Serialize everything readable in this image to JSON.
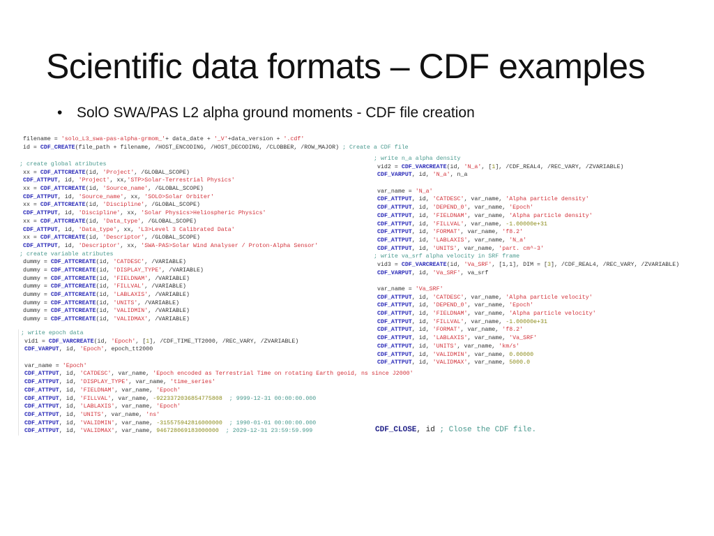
{
  "slide": {
    "title": "Scientific data formats – CDF examples",
    "bullet_icon": "•",
    "bullet": "SolO SWA/PAS L2 alpha ground moments  - CDF file creation"
  },
  "code_top": [
    [
      [
        "",
        " filename = "
      ],
      [
        "str",
        "'solo_L3_swa-pas-alpha-grmom_'"
      ],
      [
        "",
        "+ data_date + "
      ],
      [
        "str",
        "'_V'"
      ],
      [
        "",
        "+data_version + "
      ],
      [
        "str",
        "'.cdf'"
      ]
    ],
    [
      [
        "",
        " id = "
      ],
      [
        "kw",
        "CDF_CREATE"
      ],
      [
        "",
        "(file_path + filename, /HOST_ENCODING, /HOST_DECODING, /CLOBBER, /ROW_MAJOR) "
      ],
      [
        "cm",
        "; Create a CDF file"
      ]
    ]
  ],
  "code_global": [
    [
      [
        "cm",
        "; create global atributes"
      ]
    ],
    [
      [
        "",
        " xx = "
      ],
      [
        "kw",
        "CDF_ATTCREATE"
      ],
      [
        "",
        "(id, "
      ],
      [
        "str",
        "'Project'"
      ],
      [
        "",
        ", /GLOBAL_SCOPE)"
      ]
    ],
    [
      [
        "",
        " "
      ],
      [
        "kw",
        "CDF_ATTPUT"
      ],
      [
        "",
        ", id, "
      ],
      [
        "str",
        "'Project'"
      ],
      [
        "",
        ", xx,"
      ],
      [
        "str",
        "'STP>Solar-Terrestrial Physics'"
      ]
    ],
    [
      [
        "",
        " xx = "
      ],
      [
        "kw",
        "CDF_ATTCREATE"
      ],
      [
        "",
        "(id, "
      ],
      [
        "str",
        "'Source_name'"
      ],
      [
        "",
        ", /GLOBAL_SCOPE)"
      ]
    ],
    [
      [
        "",
        " "
      ],
      [
        "kw",
        "CDF_ATTPUT"
      ],
      [
        "",
        ", id, "
      ],
      [
        "str",
        "'Source_name'"
      ],
      [
        "",
        ", xx, "
      ],
      [
        "str",
        "'SOLO>Solar Orbiter'"
      ]
    ],
    [
      [
        "",
        " xx = "
      ],
      [
        "kw",
        "CDF_ATTCREATE"
      ],
      [
        "",
        "(id, "
      ],
      [
        "str",
        "'Discipline'"
      ],
      [
        "",
        ", /GLOBAL_SCOPE)"
      ]
    ],
    [
      [
        "",
        " "
      ],
      [
        "kw",
        "CDF_ATTPUT"
      ],
      [
        "",
        ", id, "
      ],
      [
        "str",
        "'Discipline'"
      ],
      [
        "",
        ", xx, "
      ],
      [
        "str",
        "'Solar Physics>Heliospheric Physics'"
      ]
    ],
    [
      [
        "",
        " xx = "
      ],
      [
        "kw",
        "CDF_ATTCREATE"
      ],
      [
        "",
        "(id, "
      ],
      [
        "str",
        "'Data_type'"
      ],
      [
        "",
        ", /GLOBAL_SCOPE)"
      ]
    ],
    [
      [
        "",
        " "
      ],
      [
        "kw",
        "CDF_ATTPUT"
      ],
      [
        "",
        ", id, "
      ],
      [
        "str",
        "'Data_type'"
      ],
      [
        "",
        ", xx, "
      ],
      [
        "str",
        "'L3>Level 3 Calibrated Data'"
      ]
    ],
    [
      [
        "",
        " xx = "
      ],
      [
        "kw",
        "CDF_ATTCREATE"
      ],
      [
        "",
        "(id, "
      ],
      [
        "str",
        "'Descriptor'"
      ],
      [
        "",
        ", /GLOBAL_SCOPE)"
      ]
    ],
    [
      [
        "",
        " "
      ],
      [
        "kw",
        "CDF_ATTPUT"
      ],
      [
        "",
        ", id, "
      ],
      [
        "str",
        "'Descriptor'"
      ],
      [
        "",
        ", xx, "
      ],
      [
        "str",
        "'SWA-PAS>Solar Wind Analyser / Proton-Alpha Sensor'"
      ]
    ],
    [
      [
        "cm",
        "; create variable atributes"
      ]
    ],
    [
      [
        "",
        " dummy = "
      ],
      [
        "kw",
        "CDF_ATTCREATE"
      ],
      [
        "",
        "(id, "
      ],
      [
        "str",
        "'CATDESC'"
      ],
      [
        "",
        ", /VARIABLE)"
      ]
    ],
    [
      [
        "",
        " dummy = "
      ],
      [
        "kw",
        "CDF_ATTCREATE"
      ],
      [
        "",
        "(id, "
      ],
      [
        "str",
        "'DISPLAY_TYPE'"
      ],
      [
        "",
        ", /VARIABLE)"
      ]
    ],
    [
      [
        "",
        " dummy = "
      ],
      [
        "kw",
        "CDF_ATTCREATE"
      ],
      [
        "",
        "(id, "
      ],
      [
        "str",
        "'FIELDNAM'"
      ],
      [
        "",
        ", /VARIABLE)"
      ]
    ],
    [
      [
        "",
        " dummy = "
      ],
      [
        "kw",
        "CDF_ATTCREATE"
      ],
      [
        "",
        "(id, "
      ],
      [
        "str",
        "'FILLVAL'"
      ],
      [
        "",
        ", /VARIABLE)"
      ]
    ],
    [
      [
        "",
        " dummy = "
      ],
      [
        "kw",
        "CDF_ATTCREATE"
      ],
      [
        "",
        "(id, "
      ],
      [
        "str",
        "'LABLAXIS'"
      ],
      [
        "",
        ", /VARIABLE)"
      ]
    ],
    [
      [
        "",
        " dummy = "
      ],
      [
        "kw",
        "CDF_ATTCREATE"
      ],
      [
        "",
        "(id, "
      ],
      [
        "str",
        "'UNITS'"
      ],
      [
        "",
        ", /VARIABLE)"
      ]
    ],
    [
      [
        "",
        " dummy = "
      ],
      [
        "kw",
        "CDF_ATTCREATE"
      ],
      [
        "",
        "(id, "
      ],
      [
        "str",
        "'VALIDMIN'"
      ],
      [
        "",
        ", /VARIABLE)"
      ]
    ],
    [
      [
        "",
        " dummy = "
      ],
      [
        "kw",
        "CDF_ATTCREATE"
      ],
      [
        "",
        "(id, "
      ],
      [
        "str",
        "'VALIDMAX'"
      ],
      [
        "",
        ", /VARIABLE)"
      ]
    ]
  ],
  "code_epoch": [
    [
      [
        "cm",
        "; write epoch data"
      ]
    ],
    [
      [
        "",
        " vid1 = "
      ],
      [
        "kw",
        "CDF_VARCREATE"
      ],
      [
        "",
        "(id, "
      ],
      [
        "str",
        "'Epoch'"
      ],
      [
        "",
        ", ["
      ],
      [
        "num",
        "1"
      ],
      [
        "",
        "], /CDF_TIME_TT2000, /REC_VARY, /ZVARIABLE)"
      ]
    ],
    [
      [
        "",
        " "
      ],
      [
        "kw",
        "CDF_VARPUT"
      ],
      [
        "",
        ", id, "
      ],
      [
        "str",
        "'Epoch'"
      ],
      [
        "",
        ", epoch_tt2000"
      ]
    ],
    [
      [
        "",
        ""
      ]
    ],
    [
      [
        "",
        " var_name = "
      ],
      [
        "str",
        "'Epoch'"
      ]
    ],
    [
      [
        "",
        " "
      ],
      [
        "kw",
        "CDF_ATTPUT"
      ],
      [
        "",
        ", id, "
      ],
      [
        "str",
        "'CATDESC'"
      ],
      [
        "",
        ", var_name, "
      ],
      [
        "str",
        "'Epoch encoded as Terrestrial Time on rotating Earth geoid, ns since J2000'"
      ]
    ],
    [
      [
        "",
        " "
      ],
      [
        "kw",
        "CDF_ATTPUT"
      ],
      [
        "",
        ", id, "
      ],
      [
        "str",
        "'DISPLAY_TYPE'"
      ],
      [
        "",
        ", var_name, "
      ],
      [
        "str",
        "'time_series'"
      ]
    ],
    [
      [
        "",
        " "
      ],
      [
        "kw",
        "CDF_ATTPUT"
      ],
      [
        "",
        ", id, "
      ],
      [
        "str",
        "'FIELDNAM'"
      ],
      [
        "",
        ", var_name, "
      ],
      [
        "str",
        "'Epoch'"
      ]
    ],
    [
      [
        "",
        " "
      ],
      [
        "kw",
        "CDF_ATTPUT"
      ],
      [
        "",
        ", id, "
      ],
      [
        "str",
        "'FILLVAL'"
      ],
      [
        "",
        ", var_name, "
      ],
      [
        "num",
        "-9223372036854775808"
      ],
      [
        "",
        "  "
      ],
      [
        "cm",
        "; 9999-12-31 00:00:00.000"
      ]
    ],
    [
      [
        "",
        " "
      ],
      [
        "kw",
        "CDF_ATTPUT"
      ],
      [
        "",
        ", id, "
      ],
      [
        "str",
        "'LABLAXIS'"
      ],
      [
        "",
        ", var_name, "
      ],
      [
        "str",
        "'Epoch'"
      ]
    ],
    [
      [
        "",
        " "
      ],
      [
        "kw",
        "CDF_ATTPUT"
      ],
      [
        "",
        ", id, "
      ],
      [
        "str",
        "'UNITS'"
      ],
      [
        "",
        ", var_name, "
      ],
      [
        "str",
        "'ns'"
      ]
    ],
    [
      [
        "",
        " "
      ],
      [
        "kw",
        "CDF_ATTPUT"
      ],
      [
        "",
        ", id, "
      ],
      [
        "str",
        "'VALIDMIN'"
      ],
      [
        "",
        ", var_name, "
      ],
      [
        "num",
        "-315575942816000000"
      ],
      [
        "",
        "  "
      ],
      [
        "cm",
        "; 1990-01-01 00:00:00.000"
      ]
    ],
    [
      [
        "",
        " "
      ],
      [
        "kw",
        "CDF_ATTPUT"
      ],
      [
        "",
        ", id, "
      ],
      [
        "str",
        "'VALIDMAX'"
      ],
      [
        "",
        ", var_name, "
      ],
      [
        "num",
        "946728069183000000"
      ],
      [
        "",
        "  "
      ],
      [
        "cm",
        "; 2029-12-31 23:59:59.999"
      ]
    ]
  ],
  "code_right": [
    [
      [
        "cm",
        "; write n_a alpha density"
      ]
    ],
    [
      [
        "",
        " vid2 = "
      ],
      [
        "kw",
        "CDF_VARCREATE"
      ],
      [
        "",
        "(id, "
      ],
      [
        "str",
        "'N_a'"
      ],
      [
        "",
        ", ["
      ],
      [
        "num",
        "1"
      ],
      [
        "",
        "], /CDF_REAL4, /REC_VARY, /ZVARIABLE)"
      ]
    ],
    [
      [
        "",
        " "
      ],
      [
        "kw",
        "CDF_VARPUT"
      ],
      [
        "",
        ", id, "
      ],
      [
        "str",
        "'N_a'"
      ],
      [
        "",
        ", n_a"
      ]
    ],
    [
      [
        "",
        ""
      ]
    ],
    [
      [
        "",
        " var_name = "
      ],
      [
        "str",
        "'N_a'"
      ]
    ],
    [
      [
        "",
        " "
      ],
      [
        "kw",
        "CDF_ATTPUT"
      ],
      [
        "",
        ", id, "
      ],
      [
        "str",
        "'CATDESC'"
      ],
      [
        "",
        ", var_name, "
      ],
      [
        "str",
        "'Alpha particle density'"
      ]
    ],
    [
      [
        "",
        " "
      ],
      [
        "kw",
        "CDF_ATTPUT"
      ],
      [
        "",
        ", id, "
      ],
      [
        "str",
        "'DEPEND_0'"
      ],
      [
        "",
        ", var_name, "
      ],
      [
        "str",
        "'Epoch'"
      ]
    ],
    [
      [
        "",
        " "
      ],
      [
        "kw",
        "CDF_ATTPUT"
      ],
      [
        "",
        ", id, "
      ],
      [
        "str",
        "'FIELDNAM'"
      ],
      [
        "",
        ", var_name, "
      ],
      [
        "str",
        "'Alpha particle density'"
      ]
    ],
    [
      [
        "",
        " "
      ],
      [
        "kw",
        "CDF_ATTPUT"
      ],
      [
        "",
        ", id, "
      ],
      [
        "str",
        "'FILLVAL'"
      ],
      [
        "",
        ", var_name, "
      ],
      [
        "num",
        "-1.00000e+31"
      ]
    ],
    [
      [
        "",
        " "
      ],
      [
        "kw",
        "CDF_ATTPUT"
      ],
      [
        "",
        ", id, "
      ],
      [
        "str",
        "'FORMAT'"
      ],
      [
        "",
        ", var_name, "
      ],
      [
        "str",
        "'f8.2'"
      ]
    ],
    [
      [
        "",
        " "
      ],
      [
        "kw",
        "CDF_ATTPUT"
      ],
      [
        "",
        ", id, "
      ],
      [
        "str",
        "'LABLAXIS'"
      ],
      [
        "",
        ", var_name, "
      ],
      [
        "str",
        "'N_a'"
      ]
    ],
    [
      [
        "",
        " "
      ],
      [
        "kw",
        "CDF_ATTPUT"
      ],
      [
        "",
        ", id, "
      ],
      [
        "str",
        "'UNITS'"
      ],
      [
        "",
        ", var_name, "
      ],
      [
        "str",
        "'part. cm^-3'"
      ]
    ],
    [
      [
        "cm",
        "; write va_srf alpha velocity in SRF frame"
      ]
    ],
    [
      [
        "",
        " vid3 = "
      ],
      [
        "kw",
        "CDF_VARCREATE"
      ],
      [
        "",
        "(id, "
      ],
      [
        "str",
        "'Va_SRF'"
      ],
      [
        "",
        ", [1,1], DIM = ["
      ],
      [
        "num",
        "3"
      ],
      [
        "",
        "], /CDF_REAL4, /REC_VARY, /ZVARIABLE)"
      ]
    ],
    [
      [
        "",
        " "
      ],
      [
        "kw",
        "CDF_VARPUT"
      ],
      [
        "",
        ", id, "
      ],
      [
        "str",
        "'Va_SRF'"
      ],
      [
        "",
        ", va_srf"
      ]
    ],
    [
      [
        "",
        ""
      ]
    ],
    [
      [
        "",
        " var_name = "
      ],
      [
        "str",
        "'Va_SRF'"
      ]
    ],
    [
      [
        "",
        " "
      ],
      [
        "kw",
        "CDF_ATTPUT"
      ],
      [
        "",
        ", id, "
      ],
      [
        "str",
        "'CATDESC'"
      ],
      [
        "",
        ", var_name, "
      ],
      [
        "str",
        "'Alpha particle velocity'"
      ]
    ],
    [
      [
        "",
        " "
      ],
      [
        "kw",
        "CDF_ATTPUT"
      ],
      [
        "",
        ", id, "
      ],
      [
        "str",
        "'DEPEND_0'"
      ],
      [
        "",
        ", var_name, "
      ],
      [
        "str",
        "'Epoch'"
      ]
    ],
    [
      [
        "",
        " "
      ],
      [
        "kw",
        "CDF_ATTPUT"
      ],
      [
        "",
        ", id, "
      ],
      [
        "str",
        "'FIELDNAM'"
      ],
      [
        "",
        ", var_name, "
      ],
      [
        "str",
        "'Alpha particle velocity'"
      ]
    ],
    [
      [
        "",
        " "
      ],
      [
        "kw",
        "CDF_ATTPUT"
      ],
      [
        "",
        ", id, "
      ],
      [
        "str",
        "'FILLVAL'"
      ],
      [
        "",
        ", var_name, "
      ],
      [
        "num",
        "-1.00000e+31"
      ]
    ],
    [
      [
        "",
        " "
      ],
      [
        "kw",
        "CDF_ATTPUT"
      ],
      [
        "",
        ", id, "
      ],
      [
        "str",
        "'FORMAT'"
      ],
      [
        "",
        ", var_name, "
      ],
      [
        "str",
        "'f8.2'"
      ]
    ],
    [
      [
        "",
        " "
      ],
      [
        "kw",
        "CDF_ATTPUT"
      ],
      [
        "",
        ", id, "
      ],
      [
        "str",
        "'LABLAXIS'"
      ],
      [
        "",
        ", var_name, "
      ],
      [
        "str",
        "'Va_SRF'"
      ]
    ],
    [
      [
        "",
        " "
      ],
      [
        "kw",
        "CDF_ATTPUT"
      ],
      [
        "",
        ", id, "
      ],
      [
        "str",
        "'UNITS'"
      ],
      [
        "",
        ", var_name, "
      ],
      [
        "str",
        "'km/s'"
      ]
    ],
    [
      [
        "",
        " "
      ],
      [
        "kw",
        "CDF_ATTPUT"
      ],
      [
        "",
        ", id, "
      ],
      [
        "str",
        "'VALIDMIN'"
      ],
      [
        "",
        ", var_name, "
      ],
      [
        "num",
        "0.00000"
      ]
    ],
    [
      [
        "",
        " "
      ],
      [
        "kw",
        "CDF_ATTPUT"
      ],
      [
        "",
        ", id, "
      ],
      [
        "str",
        "'VALIDMAX'"
      ],
      [
        "",
        ", var_name, "
      ],
      [
        "num",
        "5000.0"
      ]
    ]
  ],
  "code_close": [
    [
      "kw",
      "CDF_CLOSE"
    ],
    [
      "",
      ", id "
    ],
    [
      "cm",
      "; Close the CDF file."
    ]
  ]
}
